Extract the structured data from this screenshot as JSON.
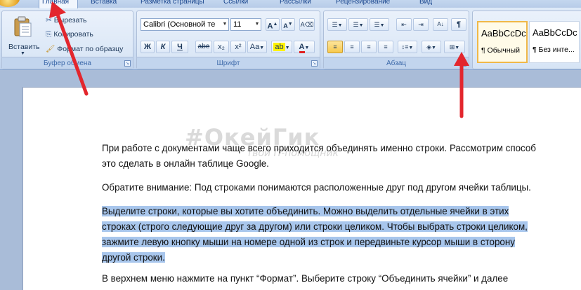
{
  "tabs": [
    {
      "label": "Главная",
      "active": true
    },
    {
      "label": "Вставка",
      "active": false
    },
    {
      "label": "Разметка страницы",
      "active": false
    },
    {
      "label": "Ссылки",
      "active": false
    },
    {
      "label": "Рассылки",
      "active": false
    },
    {
      "label": "Рецензирование",
      "active": false
    },
    {
      "label": "Вид",
      "active": false
    }
  ],
  "clipboard": {
    "paste_label": "Вставить",
    "cut_label": "Вырезать",
    "copy_label": "Копировать",
    "format_painter_label": "Формат по образцу",
    "group_label": "Буфер обмена"
  },
  "font": {
    "font_name": "Calibri (Основной те",
    "font_size": "11",
    "bold": "Ж",
    "italic": "К",
    "underline": "Ч",
    "strikethrough": "abe",
    "subscript": "x₂",
    "superscript": "x²",
    "change_case": "Aa",
    "grow": "A",
    "shrink": "A",
    "group_label": "Шрифт"
  },
  "paragraph": {
    "group_label": "Абзац"
  },
  "styles": [
    {
      "sample": "AaBbCcDc",
      "name": "¶ Обычный",
      "selected": true
    },
    {
      "sample": "AaBbCcDc",
      "name": "¶ Без инте...",
      "selected": false
    }
  ],
  "watermark": {
    "main": "#ОкейГик",
    "sub": "твой IT-помощник"
  },
  "document": {
    "para1": "При работе с документами чаще всего приходится объединять именно строки. Рассмотрим способ это сделать в онлайн таблице Google.",
    "para2": "Обратите внимание: Под строками понимаются расположенные друг под другом ячейки таблицы.",
    "para3_lines": [
      "Выделите строки, которые вы хотите объединить. Можно выделить отдельные ячейки в этих",
      "строках (строго следующие друг за другом) или строки целиком. Чтобы выбрать строки целиком,",
      "зажмите левую кнопку мыши на номере одной из строк и передвиньте курсор мыши в сторону",
      "другой строки."
    ],
    "para4": "В верхнем меню нажмите на пункт “Формат”. Выберите строку “Объединить ячейки” и далее"
  },
  "colors": {
    "highlight": "#a8c6ec",
    "arrow": "#e3262d",
    "ribbon_text": "#15428b"
  }
}
